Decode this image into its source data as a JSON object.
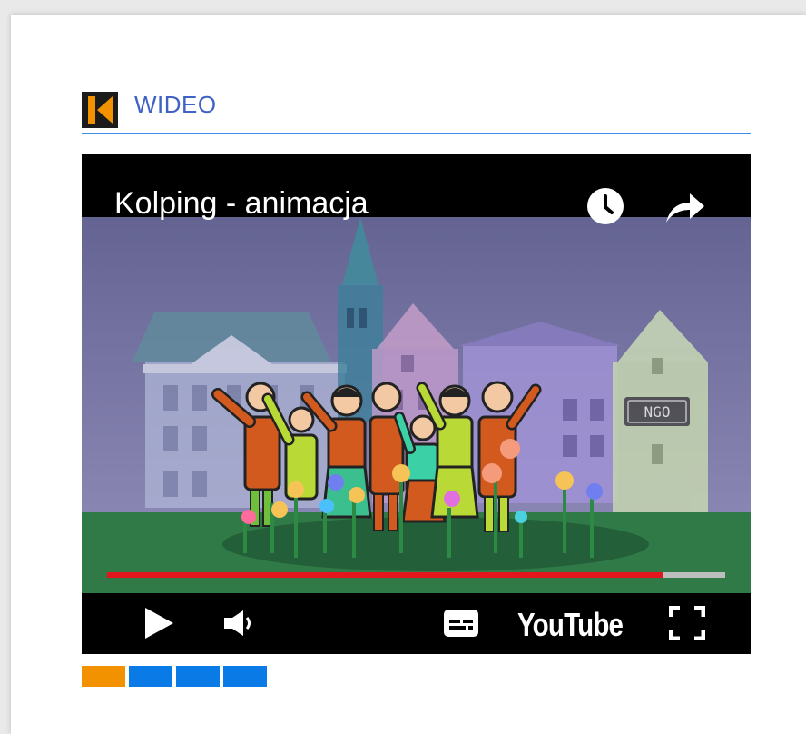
{
  "widget": {
    "title": "WIDEO",
    "logo_icon": "kolping-k-logo",
    "accent": "#3d8ee8",
    "title_color": "#3f62c4"
  },
  "player": {
    "video_title": "Kolping - animacja",
    "brand": "YouTube",
    "sign_text": "NGO",
    "progress": 0.9,
    "progress_color": "#e3161d",
    "icons": [
      "watch-later-icon",
      "share-icon",
      "play-icon",
      "volume-icon",
      "subtitles-icon",
      "fullscreen-icon"
    ]
  },
  "carousel": {
    "tabs": [
      {
        "name": "tab-1",
        "color": "#f39200",
        "active": true
      },
      {
        "name": "tab-2",
        "color": "#0a7ae6",
        "active": false
      },
      {
        "name": "tab-3",
        "color": "#0a7ae6",
        "active": false
      },
      {
        "name": "tab-4",
        "color": "#0a7ae6",
        "active": false
      }
    ]
  }
}
